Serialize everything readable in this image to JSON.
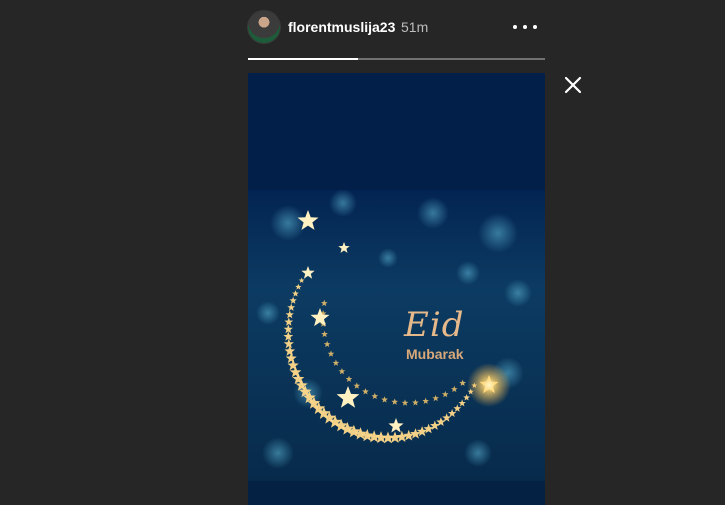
{
  "story": {
    "username": "florentmuslija23",
    "timestamp": "51m",
    "progress": 0.37,
    "image_text": {
      "title": "Eid",
      "subtitle": "Mubarak"
    }
  },
  "icons": {
    "more": "more-horizontal-icon",
    "close": "close-icon"
  },
  "colors": {
    "background": "#262626",
    "story_bg": "#032452",
    "gold": "#e6b98b"
  }
}
